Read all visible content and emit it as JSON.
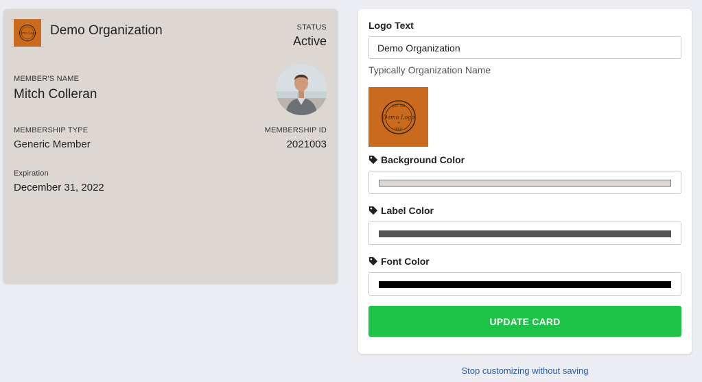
{
  "card": {
    "org_name": "Demo Organization",
    "status_label": "STATUS",
    "status_value": "Active",
    "member_name_label": "MEMBER'S NAME",
    "member_name": "Mitch Colleran",
    "membership_type_label": "MEMBERSHIP TYPE",
    "membership_type": "Generic Member",
    "membership_id_label": "MEMBERSHIP ID",
    "membership_id": "2021003",
    "expiration_label": "Expiration",
    "expiration": "December 31, 2022"
  },
  "logo": {
    "text_lines": [
      "JUST THE",
      "Demo Logo",
      "DOGE"
    ],
    "background_color": "#c96a1d"
  },
  "panel": {
    "logo_text_label": "Logo Text",
    "logo_text_value": "Demo Organization",
    "logo_text_helper": "Typically Organization Name",
    "background_color_label": "Background Color",
    "background_color_value": "#dcd7d2",
    "label_color_label": "Label Color",
    "label_color_value": "#555555",
    "font_color_label": "Font Color",
    "font_color_value": "#000000",
    "update_button": "UPDATE CARD"
  },
  "footer": {
    "stop_link": "Stop customizing without saving"
  },
  "colors": {
    "accent_green": "#1ec447",
    "link_blue": "#2a5d9e",
    "page_bg": "#ecedf2"
  },
  "icons": {
    "tag": "tag-icon"
  }
}
